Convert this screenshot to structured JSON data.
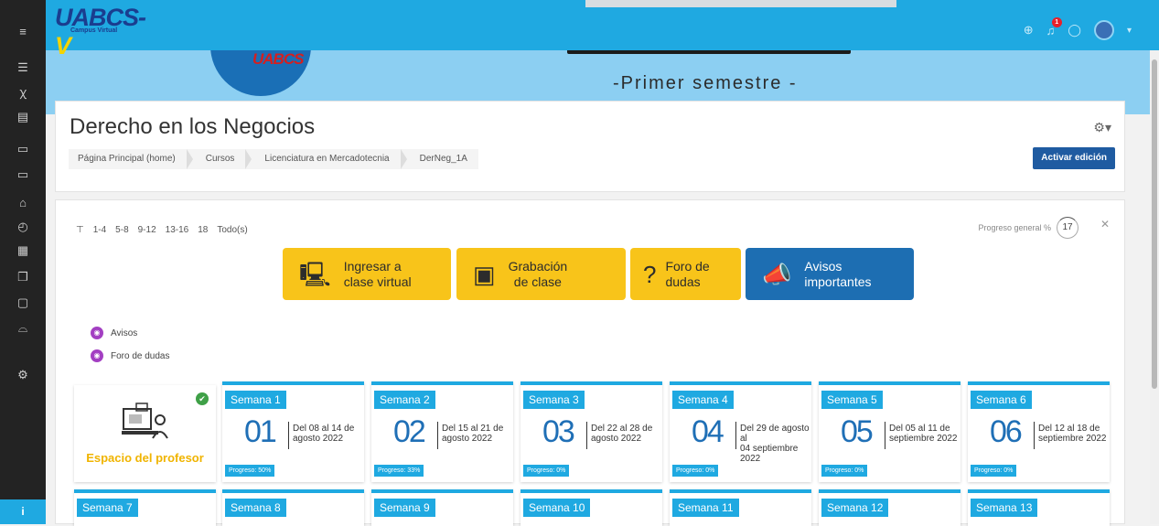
{
  "topbar": {
    "logo": "UABCS-V",
    "logo_sub": "Campus Virtual",
    "notification_count": "1"
  },
  "sidebar": {
    "icons": [
      "menu-icon",
      "list-icon",
      "users-icon",
      "book-icon",
      "folder-icon",
      "folder-icon",
      "home-icon",
      "dashboard-icon",
      "calendar-icon",
      "files-icon",
      "clipboard-icon",
      "graduation-icon",
      "settings-icon"
    ],
    "info": "i"
  },
  "banner": {
    "logo": "UABCS",
    "subtitle": "-Primer semestre -"
  },
  "header": {
    "title": "Derecho en los Negocios",
    "breadcrumb": [
      "Página Principal (home)",
      "Cursos",
      "Licenciatura en Mercadotecnia",
      "DerNeg_1A"
    ],
    "edit_button": "Activar edición"
  },
  "filters": [
    "1-4",
    "5-8",
    "9-12",
    "13-16",
    "18",
    "Todo(s)"
  ],
  "progress": {
    "label": "Progreso general %",
    "value": "17"
  },
  "quick_buttons": [
    {
      "label1": "Ingresar a",
      "label2": "clase virtual"
    },
    {
      "label1": "Grabación",
      "label2": "de clase"
    },
    {
      "label1": "Foro de",
      "label2": "dudas"
    },
    {
      "label1": "Avisos",
      "label2": "importantes"
    }
  ],
  "activities": [
    {
      "label": "Avisos"
    },
    {
      "label": "Foro de dudas"
    }
  ],
  "professor": {
    "label": "Espacio del profesor"
  },
  "weeks": [
    {
      "tag": "Semana 1",
      "num": "01",
      "date1": "Del 08 al 14 de",
      "date2": "agosto 2022",
      "progress": "Progreso: 50%"
    },
    {
      "tag": "Semana 2",
      "num": "02",
      "date1": "Del 15 al 21 de",
      "date2": "agosto 2022",
      "progress": "Progreso: 33%"
    },
    {
      "tag": "Semana 3",
      "num": "03",
      "date1": "Del 22 al 28 de",
      "date2": "agosto 2022",
      "progress": "Progreso: 0%"
    },
    {
      "tag": "Semana 4",
      "num": "04",
      "date1": "Del 29 de agosto al",
      "date2": "04 septiembre 2022",
      "progress": "Progreso: 0%"
    },
    {
      "tag": "Semana 5",
      "num": "05",
      "date1": "Del 05 al 11 de",
      "date2": "septiembre 2022",
      "progress": "Progreso: 0%"
    },
    {
      "tag": "Semana 6",
      "num": "06",
      "date1": "Del 12 al 18 de",
      "date2": "septiembre 2022",
      "progress": "Progreso: 0%"
    }
  ],
  "weeks_row2": [
    "Semana 7",
    "Semana 8",
    "Semana 9",
    "Semana 10",
    "Semana 11",
    "Semana 12",
    "Semana 13"
  ]
}
